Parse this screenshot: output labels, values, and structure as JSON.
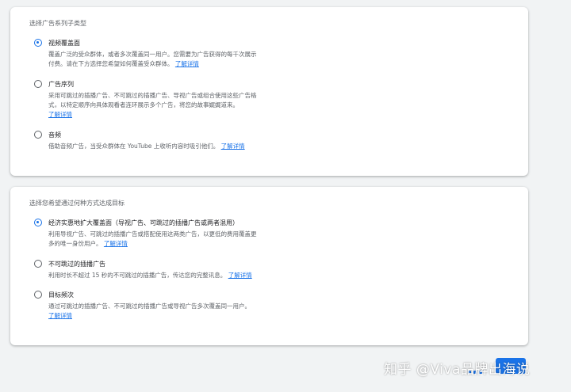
{
  "section1": {
    "title": "选择广告系列子类型",
    "options": [
      {
        "label": "视频覆盖面",
        "checked": true,
        "line1": "覆盖广泛的受众群体，或者多次覆盖同一用户。您需要为广告获得的每千次展示",
        "line2": "付费。请在下方选择您希望如何覆盖受众群体。",
        "link": "了解详情"
      },
      {
        "label": "广告序列",
        "checked": false,
        "line1": "采用可跳过的插播广告、不可跳过的插播广告、导视广告或组合使用这些广告格",
        "line2": "式，以特定顺序向具体观看者连环展示多个广告，将您的故事娓娓道来。",
        "link": "了解详情"
      },
      {
        "label": "音频",
        "checked": false,
        "line1": "借助音频广告，当受众群体在 YouTube 上收听内容时吸引他们。",
        "link": "了解详情"
      }
    ]
  },
  "section2": {
    "title": "选择您希望通过何种方式达成目标",
    "options": [
      {
        "label": "经济实惠地扩大覆盖面（导视广告、可跳过的插播广告或两者混用）",
        "checked": true,
        "line1": "利用导视广告、可跳过的插播广告或搭配使用这两类广告，以更低的费用覆盖更",
        "line2": "多的唯一身份用户。",
        "link": "了解详情"
      },
      {
        "label": "不可跳过的插播广告",
        "checked": false,
        "line1": "利用时长不超过 15 秒的不可跳过的插播广告，传达您的完整讯息。",
        "link": "了解详情"
      },
      {
        "label": "目标频次",
        "checked": false,
        "line1": "通过可跳过的插播广告、不可跳过的插播广告或导视广告多次覆盖同一用户。",
        "link": "了解详情"
      }
    ]
  },
  "watermark": "知乎 @Viva品牌出海说",
  "colors": {
    "accent": "#1a73e8",
    "background": "#f1f3f4"
  }
}
